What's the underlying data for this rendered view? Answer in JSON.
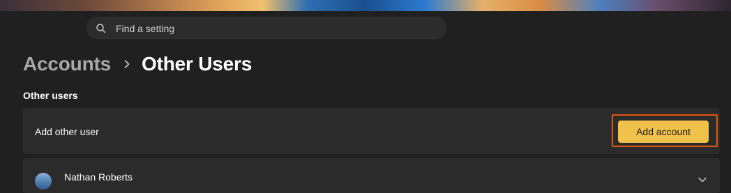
{
  "search": {
    "placeholder": "Find a setting"
  },
  "breadcrumb": {
    "parent": "Accounts",
    "current": "Other Users"
  },
  "section": {
    "title": "Other users"
  },
  "add_user_card": {
    "label": "Add other user",
    "button_label": "Add account"
  },
  "users": [
    {
      "name": "Nathan Roberts"
    }
  ],
  "colors": {
    "accent": "#f0c14b",
    "highlight": "#e4570f",
    "background": "#202020",
    "card": "#2b2b2b"
  },
  "icons": [
    "search-icon",
    "chevron-right-icon",
    "chevron-down-icon"
  ]
}
